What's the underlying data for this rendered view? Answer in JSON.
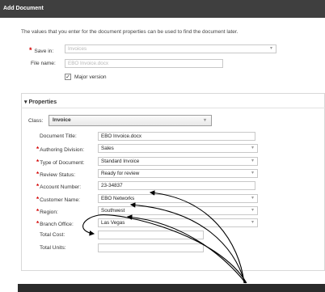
{
  "window": {
    "title": "Add Document"
  },
  "intro_text": "The values that you enter for the document properties can be used to find the document later.",
  "save_in": {
    "label": "Save in:",
    "value": "Invoices"
  },
  "file_name": {
    "label": "File name:",
    "value": "EBO Invoice.docx"
  },
  "major_version": {
    "label": "Major version",
    "checked": true,
    "mark": "✓"
  },
  "properties": {
    "header": "▾ Properties",
    "class_label": "Class:",
    "class_value": "Invoice",
    "fields": [
      {
        "label": "Document Title:",
        "required": false,
        "value": "EBO Invoice.docx",
        "dropdown": false
      },
      {
        "label": "Authoring Division:",
        "required": true,
        "value": "Sales",
        "dropdown": true
      },
      {
        "label": "Type of Document:",
        "required": true,
        "value": "Standard Invoice",
        "dropdown": true
      },
      {
        "label": "Review Status:",
        "required": true,
        "value": "Ready for review",
        "dropdown": true
      },
      {
        "label": "Account Number:",
        "required": true,
        "value": "23-34837",
        "dropdown": false
      },
      {
        "label": "Customer Name:",
        "required": true,
        "value": "EBO Networks",
        "dropdown": true
      },
      {
        "label": "Region:",
        "required": true,
        "value": "Southwest",
        "dropdown": true
      },
      {
        "label": "Branch Office:",
        "required": true,
        "value": "Las Vegas",
        "dropdown": true
      },
      {
        "label": "Total Cost:",
        "required": false,
        "value": "",
        "dropdown": false
      },
      {
        "label": "Total Units:",
        "required": false,
        "value": "",
        "dropdown": false
      }
    ]
  },
  "icons": {
    "required": "*",
    "dropdown": "chevron-down-icon",
    "collapse": "triangle-down-icon"
  },
  "colors": {
    "titlebar": "#3f3f3f",
    "required": "#d40000",
    "footer": "#2b2b2b",
    "arrows": "#000000"
  }
}
